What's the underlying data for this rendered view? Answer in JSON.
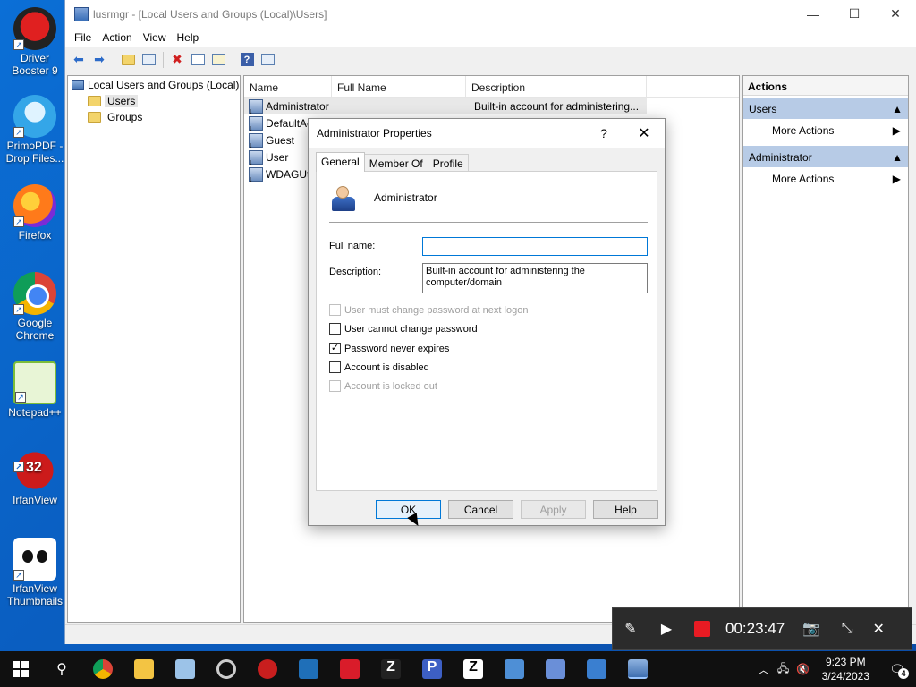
{
  "desktop": {
    "icons": [
      {
        "label": "Driver Booster 9"
      },
      {
        "label": "PrimoPDF - Drop Files..."
      },
      {
        "label": "Firefox"
      },
      {
        "label": "Google Chrome"
      },
      {
        "label": "Notepad++"
      },
      {
        "label": "IrfanView",
        "badge": "32"
      },
      {
        "label": "IrfanView Thumbnails"
      }
    ]
  },
  "window": {
    "title": "lusrmgr - [Local Users and Groups (Local)\\Users]",
    "menu": [
      "File",
      "Action",
      "View",
      "Help"
    ],
    "toolbar_icons": [
      "back-icon",
      "forward-icon",
      "up-folder-icon",
      "show-tree-icon",
      "delete-icon",
      "properties-icon",
      "export-icon",
      "help-icon",
      "show-action-pane-icon"
    ]
  },
  "tree": {
    "root": "Local Users and Groups (Local)",
    "items": [
      "Users",
      "Groups"
    ],
    "selected": "Users"
  },
  "list": {
    "columns": [
      "Name",
      "Full Name",
      "Description"
    ],
    "rows": [
      {
        "name": "Administrator",
        "full_name": "",
        "description": "Built-in account for administering..."
      },
      {
        "name": "DefaultAc",
        "full_name": "",
        "description": ""
      },
      {
        "name": "Guest",
        "full_name": "",
        "description": ""
      },
      {
        "name": "User",
        "full_name": "",
        "description": ""
      },
      {
        "name": "WDAGUti",
        "full_name": "",
        "description": ""
      }
    ]
  },
  "actions": {
    "title": "Actions",
    "sections": [
      {
        "header": "Users",
        "item": "More Actions"
      },
      {
        "header": "Administrator",
        "item": "More Actions"
      }
    ]
  },
  "dialog": {
    "title": "Administrator Properties",
    "help_glyph": "?",
    "close_glyph": "✕",
    "tabs": [
      "General",
      "Member Of",
      "Profile"
    ],
    "active_tab": "General",
    "account_name": "Administrator",
    "full_name_label": "Full name:",
    "full_name_value": "",
    "description_label": "Description:",
    "description_value": "Built-in account for administering the computer/domain",
    "checkboxes": [
      {
        "label": "User must change password at next logon",
        "checked": false,
        "enabled": false
      },
      {
        "label": "User cannot change password",
        "checked": false,
        "enabled": true
      },
      {
        "label": "Password never expires",
        "checked": true,
        "enabled": true
      },
      {
        "label": "Account is disabled",
        "checked": false,
        "enabled": true
      },
      {
        "label": "Account is locked out",
        "checked": false,
        "enabled": false
      }
    ],
    "buttons": {
      "ok": "OK",
      "cancel": "Cancel",
      "apply": "Apply",
      "help": "Help"
    }
  },
  "recorder": {
    "time": "00:23:47"
  },
  "taskbar": {
    "clock_time": "9:23 PM",
    "clock_date": "3/24/2023",
    "notification_count": "4",
    "pinned": [
      "search-icon",
      "chrome-icon",
      "file-explorer-icon",
      "app-icon-1",
      "app-icon-2",
      "driver-booster-icon",
      "security-icon",
      "recorder-icon",
      "z-app-icon",
      "primopdf-icon",
      "zotero-icon",
      "app-icon-3",
      "app-icon-4",
      "app-icon-5",
      "lusrmgr-icon"
    ]
  },
  "colors": {
    "accent": "#0078d7",
    "selection": "#e5e5e5",
    "action_header": "#b7cbe6",
    "taskbar": "#101010",
    "record_red": "#e81b23"
  }
}
